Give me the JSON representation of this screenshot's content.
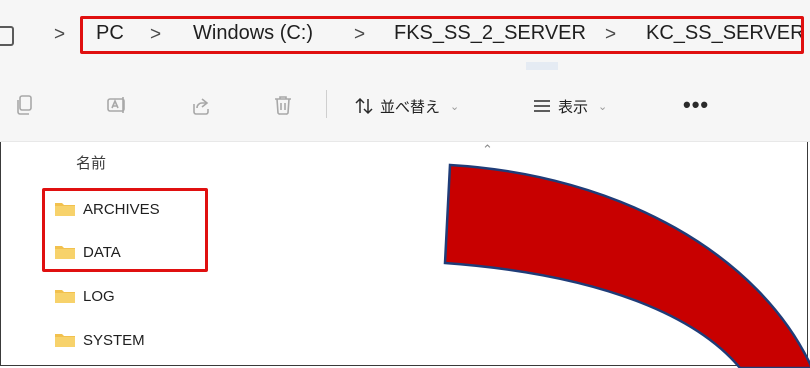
{
  "breadcrumb": {
    "items": [
      "PC",
      "Windows (C:)",
      "FKS_SS_2_SERVER",
      "KC_SS_SERVER"
    ],
    "separator": ">"
  },
  "toolbar": {
    "icons": [
      "copy-icon",
      "rename-icon",
      "share-icon",
      "delete-icon"
    ],
    "sort_label": "並べ替え",
    "view_label": "表示",
    "more_label": "•••"
  },
  "list": {
    "column_name": "名前",
    "folders": [
      "ARCHIVES",
      "DATA",
      "LOG",
      "SYSTEM"
    ]
  },
  "colors": {
    "highlight": "#e01010",
    "arrow_fill": "#c80000",
    "arrow_stroke": "#1f3c78",
    "folder": "#f2c14e"
  }
}
